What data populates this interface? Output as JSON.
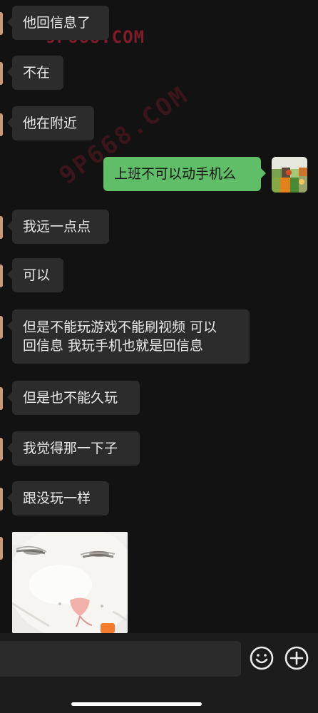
{
  "chat": {
    "messages": [
      {
        "sender": "other",
        "text": "他回信息了"
      },
      {
        "sender": "other",
        "text": "不在"
      },
      {
        "sender": "other",
        "text": "他在附近"
      },
      {
        "sender": "self",
        "text": "上班不可以动手机么"
      },
      {
        "sender": "other",
        "text": "我远一点点"
      },
      {
        "sender": "other",
        "text": "可以"
      },
      {
        "sender": "other",
        "lines": [
          "但是不能玩游戏不能刷视频 可以",
          "回信息 我玩手机也就是回信息"
        ]
      },
      {
        "sender": "other",
        "text": "但是也不能久玩"
      },
      {
        "sender": "other",
        "text": "我觉得那一下子"
      },
      {
        "sender": "other",
        "text": "跟没玩一样"
      },
      {
        "sender": "other",
        "type": "sticker",
        "sticker": "white-cat-face"
      }
    ]
  },
  "watermark": {
    "main": "9P668.COM",
    "diagonal": "9P668.COM"
  },
  "input_bar": {
    "icons": [
      "emoji-icon",
      "plus-icon"
    ]
  },
  "colors": {
    "background": "#121212",
    "other_bubble": "#2c2c2c",
    "self_bubble": "#5fbe67",
    "watermark": "#8d1d2d"
  }
}
